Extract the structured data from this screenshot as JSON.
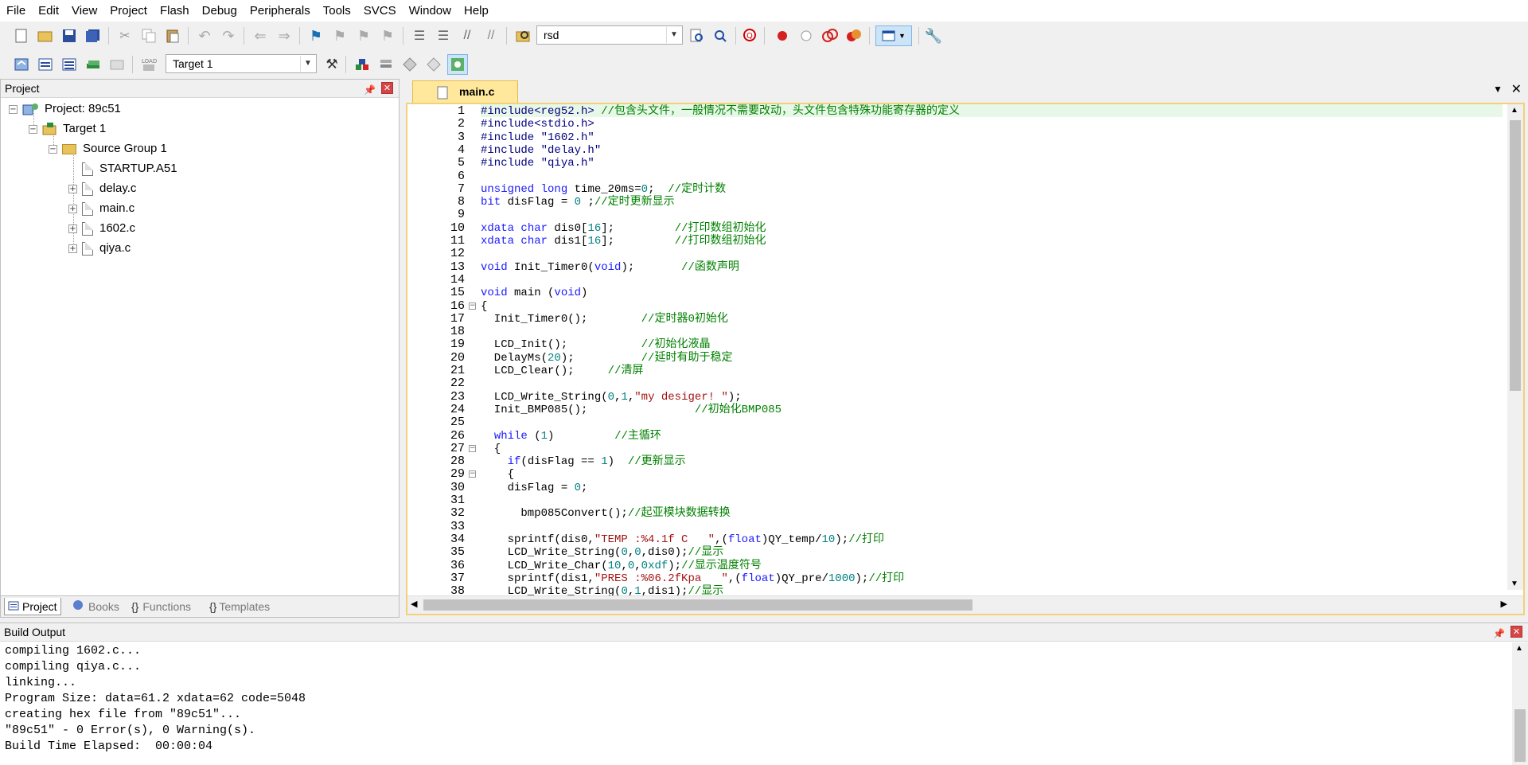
{
  "menu": [
    "File",
    "Edit",
    "View",
    "Project",
    "Flash",
    "Debug",
    "Peripherals",
    "Tools",
    "SVCS",
    "Window",
    "Help"
  ],
  "toolbar": {
    "find_combo_value": "rsd",
    "target_combo_value": "Target 1"
  },
  "project_panel": {
    "title": "Project",
    "tree": {
      "project": "Project: 89c51",
      "target": "Target 1",
      "group": "Source Group 1",
      "files": [
        "STARTUP.A51",
        "delay.c",
        "main.c",
        "1602.c",
        "qiya.c"
      ]
    },
    "tabs": [
      "Project",
      "Books",
      "Functions",
      "Templates"
    ]
  },
  "editor": {
    "active_tab": "main.c",
    "line_numbers": [
      "1",
      "2",
      "3",
      "4",
      "5",
      "6",
      "7",
      "8",
      "9",
      "10",
      "11",
      "12",
      "13",
      "14",
      "15",
      "16",
      "17",
      "18",
      "19",
      "20",
      "21",
      "22",
      "23",
      "24",
      "25",
      "26",
      "27",
      "28",
      "29",
      "30",
      "31",
      "32",
      "33",
      "34",
      "35",
      "36",
      "37",
      "38"
    ],
    "lines": [
      "#include<reg52.h> //包含头文件，一般情况不需要改动，头文件包含特殊功能寄存器的定义",
      "#include<stdio.h>",
      "#include \"1602.h\"",
      "#include \"delay.h\"",
      "#include \"qiya.h\"",
      "",
      "unsigned long time_20ms=0;  //定时计数",
      "bit disFlag = 0 ;//定时更新显示",
      "",
      "xdata char dis0[16];         //打印数组初始化",
      "xdata char dis1[16];         //打印数组初始化",
      "",
      "void Init_Timer0(void);       //函数声明",
      "",
      "void main (void)",
      "{",
      "  Init_Timer0();        //定时器0初始化",
      "",
      "  LCD_Init();           //初始化液晶",
      "  DelayMs(20);          //延时有助于稳定",
      "  LCD_Clear();     //清屏",
      "",
      "  LCD_Write_String(0,1,\"my desiger! \");",
      "  Init_BMP085();                //初始化BMP085",
      "",
      "  while (1)         //主循环",
      "  {",
      "    if(disFlag == 1)  //更新显示",
      "    {",
      "    disFlag = 0;",
      "",
      "      bmp085Convert();//起亚模块数据转换",
      "",
      "    sprintf(dis0,\"TEMP :%4.1f C   \",(float)QY_temp/10);//打印",
      "    LCD_Write_String(0,0,dis0);//显示",
      "    LCD_Write_Char(10,0,0xdf);//显示温度符号",
      "    sprintf(dis1,\"PRES :%06.2fKpa   \",(float)QY_pre/1000);//打印",
      "    LCD_Write_String(0,1,dis1);//显示"
    ]
  },
  "build_output": {
    "title": "Build Output",
    "lines": [
      "compiling 1602.c...",
      "compiling qiya.c...",
      "linking...",
      "Program Size: data=61.2 xdata=62 code=5048",
      "creating hex file from \"89c51\"...",
      "\"89c51\" - 0 Error(s), 0 Warning(s).",
      "Build Time Elapsed:  00:00:04"
    ]
  },
  "colors": {
    "keyword": "#1a1aff",
    "number": "#008080",
    "string": "#a31515",
    "comment": "#008000",
    "tab_active": "#ffe89c"
  }
}
